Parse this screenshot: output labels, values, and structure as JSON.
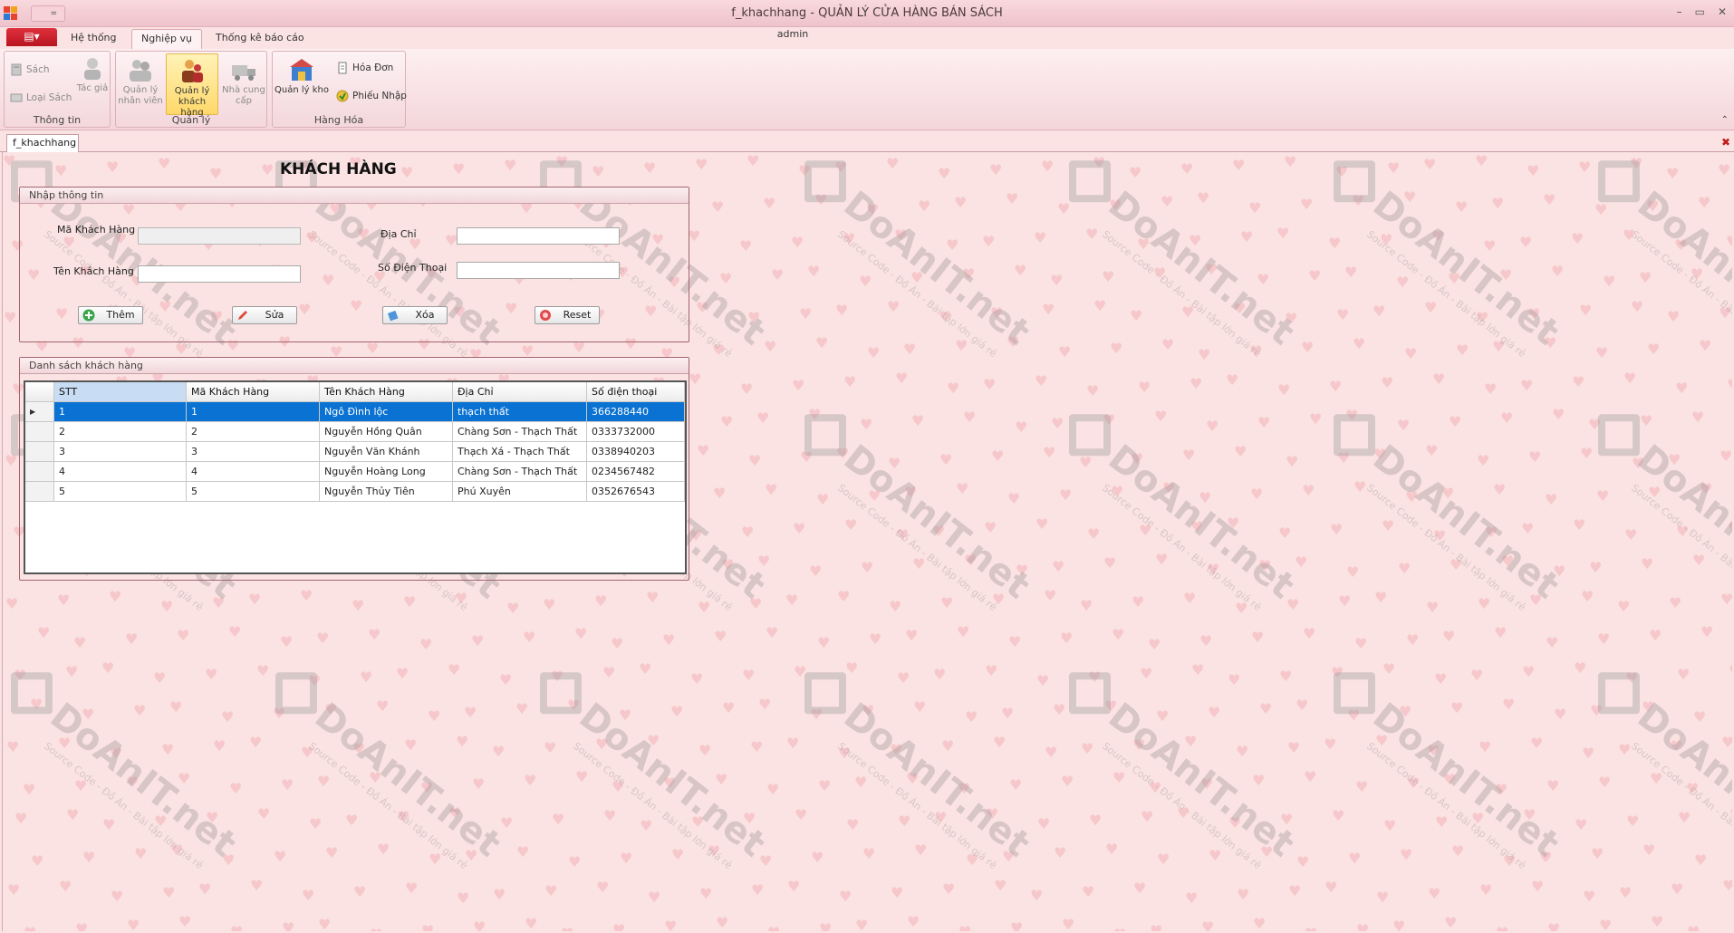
{
  "window": {
    "title": "f_khachhang - QUẢN LÝ CỬA HÀNG BÁN SÁCH",
    "user": "admin",
    "qat_label": "=",
    "controls": [
      "–",
      "▭",
      "✕"
    ]
  },
  "ribbon": {
    "file_label": "▤▾",
    "tabs": [
      "Hệ thống",
      "Nghiệp vụ",
      "Thống kê báo cáo"
    ],
    "active_tab": "Nghiệp vụ",
    "groups": {
      "thong_tin": {
        "label": "Thông tin",
        "buttons": [
          "Sách",
          "Loại Sách",
          "Tác giả"
        ]
      },
      "quan_ly": {
        "label": "Quản lý",
        "buttons": [
          "Quản lý nhân viên",
          "Quản lý khách hàng",
          "Nhà cung cấp"
        ],
        "line1": [
          "Quản lý",
          "Quản lý",
          "Nhà cung"
        ],
        "line2": [
          "nhân viên",
          "khách hàng",
          "cấp"
        ]
      },
      "hang_hoa": {
        "label": "Hàng Hóa",
        "buttons": [
          "Quản lý kho",
          "Hóa Đơn",
          "Phiếu Nhập"
        ]
      }
    },
    "collapse_icon": "⌃"
  },
  "doc_tab": {
    "label": "f_khachhang",
    "close": "✖"
  },
  "page": {
    "title": "KHÁCH HÀNG",
    "input_box": {
      "legend": "Nhập thông tin",
      "fields": {
        "ma_kh": {
          "label": "Mã Khách Hàng",
          "value": ""
        },
        "ten_kh": {
          "label": "Tên Khách Hàng",
          "value": ""
        },
        "dia_chi": {
          "label": "Địa Chỉ",
          "value": ""
        },
        "sdt": {
          "label": "Số Điện Thoại",
          "value": ""
        }
      },
      "buttons": {
        "add": "Thêm",
        "edit": "Sửa",
        "delete": "Xóa",
        "reset": "Reset"
      }
    },
    "list_box": {
      "legend": "Danh sách khách hàng",
      "columns": [
        "STT",
        "Mã Khách Hàng",
        "Tên Khách Hàng",
        "Địa Chỉ",
        "Số điện thoại"
      ],
      "rows": [
        [
          "1",
          "1",
          "Ngô Đình lộc",
          "thạch thất",
          "366288440"
        ],
        [
          "2",
          "2",
          "Nguyễn Hồng Quân",
          "Chàng Sơn - Thạch Thất",
          "0333732000"
        ],
        [
          "3",
          "3",
          "Nguyễn Văn Khánh",
          "Thạch Xá - Thạch Thất",
          "0338940203"
        ],
        [
          "4",
          "4",
          "Nguyễn Hoàng Long",
          "Chàng Sơn - Thạch Thất",
          "0234567482"
        ],
        [
          "5",
          "5",
          "Nguyễn Thủy Tiên",
          "Phú Xuyên",
          "0352676543"
        ]
      ],
      "selected_row": 0,
      "row_indicator": "▶"
    }
  },
  "watermark": {
    "brand": "DoAnIT.net",
    "sub": "Source Code - Đồ Án - Bài tập lớn giá rẻ"
  },
  "colors": {
    "accent": "#0a72d2",
    "file_button": "#c8202c",
    "background": "#fbe3e3"
  }
}
